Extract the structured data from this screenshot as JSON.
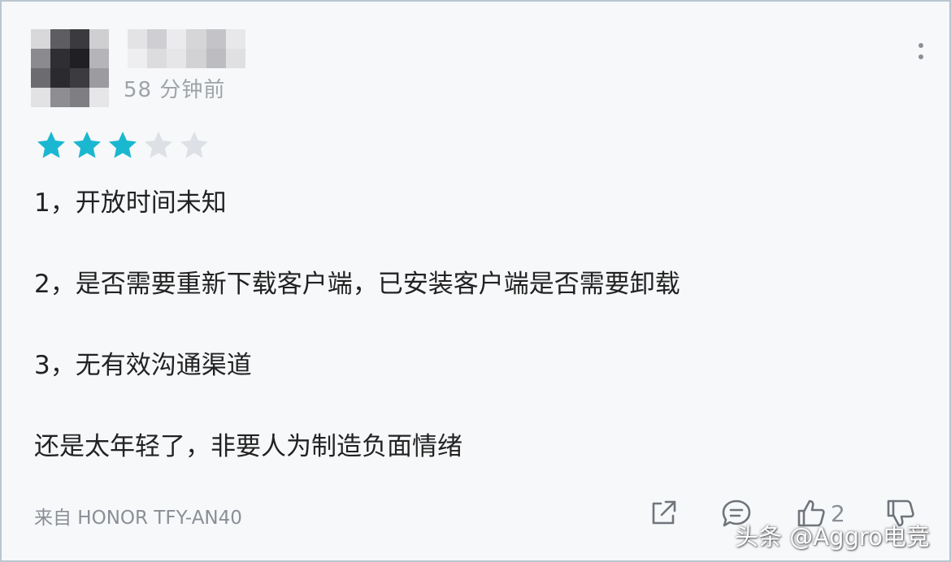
{
  "user": {
    "timestamp": "58 分钟前",
    "avatar_colors": [
      "#d8d8da",
      "#5d5d62",
      "#3a3a3f",
      "#cfcfd2",
      "#8a8a8f",
      "#2e2e33",
      "#1f1f24",
      "#b5b5b9",
      "#6b6b70",
      "#2a2a2f",
      "#3b3b40",
      "#9c9ca0",
      "#e2e2e4",
      "#8d8d92",
      "#7e7e83",
      "#e6e6e8"
    ],
    "name_blur_colors": [
      "#e3e3e5",
      "#cfcfd3",
      "#ebebed",
      "#d6d6d9",
      "#c4c4c8",
      "#e8e8ea",
      "#eeeef0",
      "#dcdcdf",
      "#e6e6e8",
      "#d2d2d5",
      "#bdbdc1",
      "#e0e0e3"
    ]
  },
  "rating": {
    "value": 3,
    "max": 5,
    "filled_color": "#1ab8d0",
    "empty_color": "#dde1e5"
  },
  "comment": {
    "lines": [
      "1，开放时间未知",
      "2，是否需要重新下载客户端，已安装客户端是否需要卸载",
      "3，无有效沟通渠道",
      "还是太年轻了，非要人为制造负面情绪"
    ]
  },
  "footer": {
    "device": "来自 HONOR TFY-AN40",
    "like_count": "2",
    "icons": [
      "share-icon",
      "comment-icon",
      "thumbs-up-icon",
      "thumbs-down-icon",
      "more-icon"
    ]
  },
  "watermark": "头条 @Aggro电竞"
}
